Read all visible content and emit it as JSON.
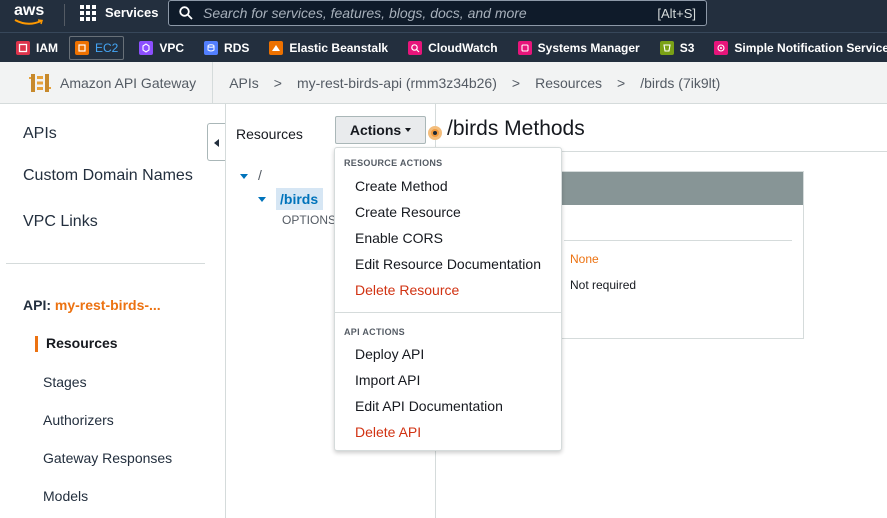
{
  "topbar": {
    "logo_text": "aws",
    "services_label": "Services",
    "search_placeholder": "Search for services, features, blogs, docs, and more",
    "search_shortcut": "[Alt+S]"
  },
  "favorites": [
    {
      "label": "IAM",
      "color": "#dd344c",
      "icon": "iam-icon"
    },
    {
      "label": "EC2",
      "color": "#ed7100",
      "icon": "ec2-icon",
      "active": true
    },
    {
      "label": "VPC",
      "color": "#8c4fff",
      "icon": "vpc-icon"
    },
    {
      "label": "RDS",
      "color": "#527fff",
      "icon": "rds-icon"
    },
    {
      "label": "Elastic Beanstalk",
      "color": "#ed7100",
      "icon": "elastic-beanstalk-icon"
    },
    {
      "label": "CloudWatch",
      "color": "#e7157b",
      "icon": "cloudwatch-icon"
    },
    {
      "label": "Systems Manager",
      "color": "#e7157b",
      "icon": "systems-manager-icon"
    },
    {
      "label": "S3",
      "color": "#7aa116",
      "icon": "s3-icon"
    },
    {
      "label": "Simple Notification Service",
      "color": "#e7157b",
      "icon": "sns-icon"
    },
    {
      "label": "",
      "color": "#ed7100",
      "icon": "lambda-icon"
    }
  ],
  "breadcrumb": {
    "service": "Amazon API Gateway",
    "items": [
      "APIs",
      "my-rest-birds-api (rmm3z34b26)",
      "Resources",
      "/birds (7ik9lt)"
    ],
    "separator": ">"
  },
  "leftnav": {
    "top_items": [
      "APIs",
      "Custom Domain Names",
      "VPC Links"
    ],
    "api_prefix": "API:",
    "api_name": "my-rest-birds-...",
    "sub_items": [
      "Resources",
      "Stages",
      "Authorizers",
      "Gateway Responses",
      "Models"
    ],
    "active": "Resources"
  },
  "resources_panel": {
    "title": "Resources",
    "root": "/",
    "child": "/birds",
    "method": "OPTIONS"
  },
  "main": {
    "title": "/birds Methods",
    "card_values": [
      "None",
      "Not required"
    ]
  },
  "actions_button": {
    "label": "Actions"
  },
  "menu": {
    "resource_actions_header": "RESOURCE ACTIONS",
    "resource_actions": [
      {
        "label": "Create Method",
        "danger": false
      },
      {
        "label": "Create Resource",
        "danger": false
      },
      {
        "label": "Enable CORS",
        "danger": false
      },
      {
        "label": "Edit Resource Documentation",
        "danger": false
      },
      {
        "label": "Delete Resource",
        "danger": true
      }
    ],
    "api_actions_header": "API ACTIONS",
    "api_actions": [
      {
        "label": "Deploy API",
        "danger": false
      },
      {
        "label": "Import API",
        "danger": false
      },
      {
        "label": "Edit API Documentation",
        "danger": false
      },
      {
        "label": "Delete API",
        "danger": true
      }
    ]
  },
  "colors": {
    "accent": "#ec7211",
    "link": "#0073bb",
    "danger": "#d13212",
    "nav_bg": "#232f3e"
  }
}
